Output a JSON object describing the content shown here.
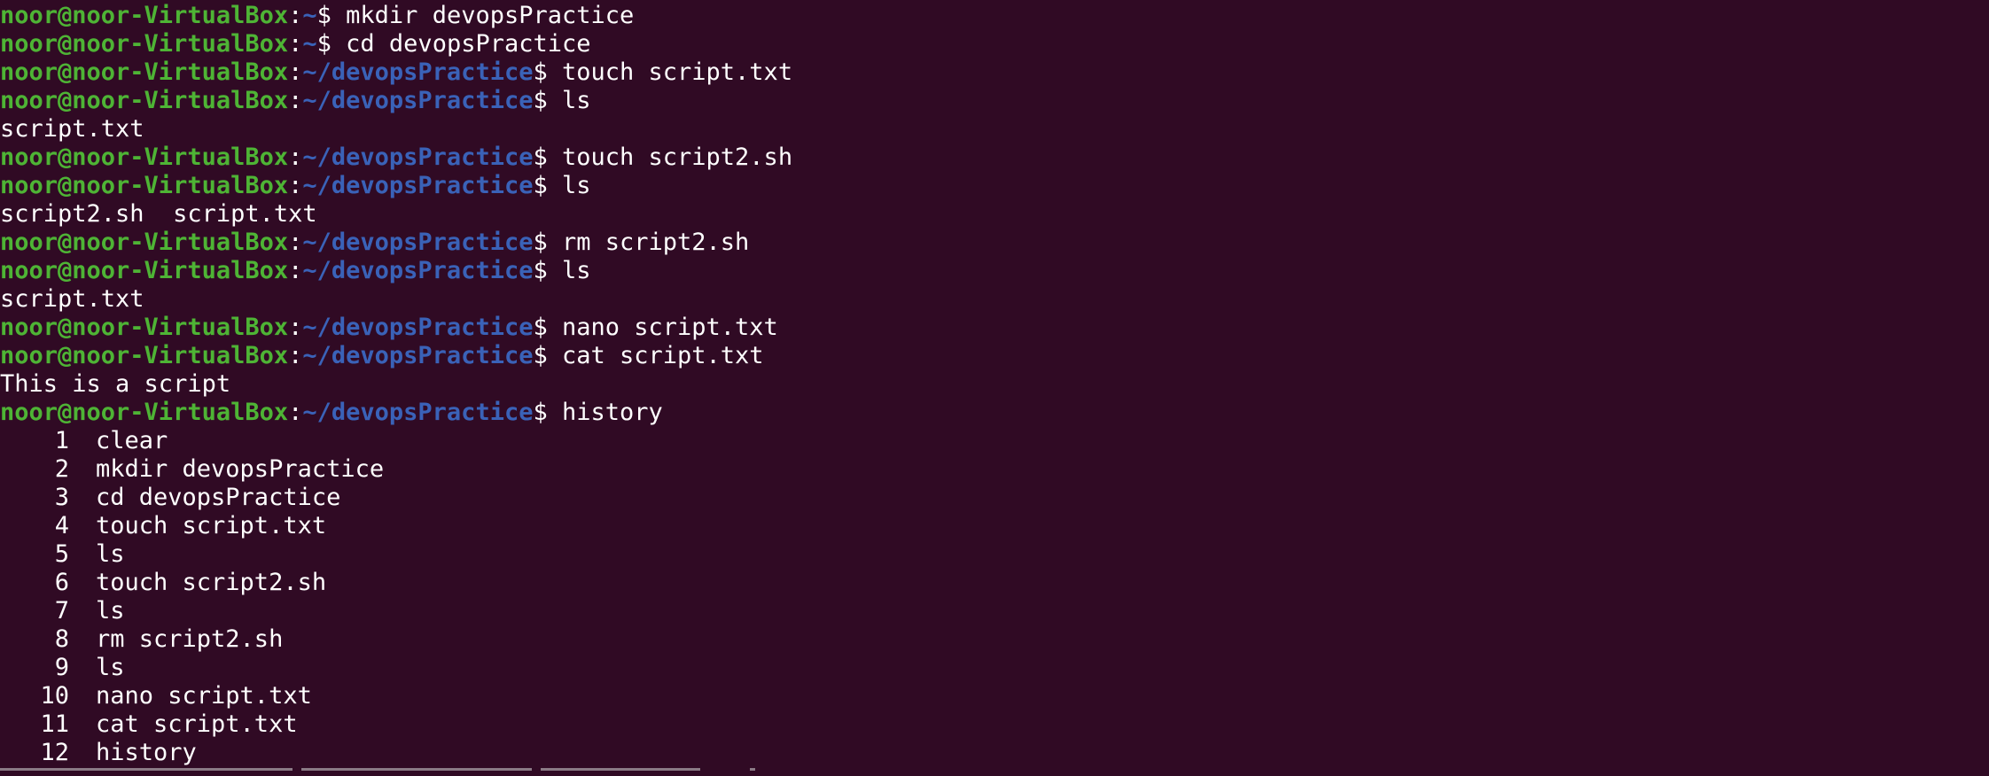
{
  "terminal": {
    "lines": [
      {
        "type": "prompt",
        "user": "noor@noor-VirtualBox",
        "sep": ":",
        "path": "~",
        "dollar": "$ ",
        "cmd": "mkdir devopsPractice"
      },
      {
        "type": "prompt",
        "user": "noor@noor-VirtualBox",
        "sep": ":",
        "path": "~",
        "dollar": "$ ",
        "cmd": "cd devopsPractice"
      },
      {
        "type": "prompt",
        "user": "noor@noor-VirtualBox",
        "sep": ":",
        "path": "~/devopsPractice",
        "dollar": "$ ",
        "cmd": "touch script.txt"
      },
      {
        "type": "prompt",
        "user": "noor@noor-VirtualBox",
        "sep": ":",
        "path": "~/devopsPractice",
        "dollar": "$ ",
        "cmd": "ls"
      },
      {
        "type": "output",
        "text": "script.txt"
      },
      {
        "type": "prompt",
        "user": "noor@noor-VirtualBox",
        "sep": ":",
        "path": "~/devopsPractice",
        "dollar": "$ ",
        "cmd": "touch script2.sh"
      },
      {
        "type": "prompt",
        "user": "noor@noor-VirtualBox",
        "sep": ":",
        "path": "~/devopsPractice",
        "dollar": "$ ",
        "cmd": "ls"
      },
      {
        "type": "output",
        "text": "script2.sh  script.txt"
      },
      {
        "type": "prompt",
        "user": "noor@noor-VirtualBox",
        "sep": ":",
        "path": "~/devopsPractice",
        "dollar": "$ ",
        "cmd": "rm script2.sh"
      },
      {
        "type": "prompt",
        "user": "noor@noor-VirtualBox",
        "sep": ":",
        "path": "~/devopsPractice",
        "dollar": "$ ",
        "cmd": "ls"
      },
      {
        "type": "output",
        "text": "script.txt"
      },
      {
        "type": "prompt",
        "user": "noor@noor-VirtualBox",
        "sep": ":",
        "path": "~/devopsPractice",
        "dollar": "$ ",
        "cmd": "nano script.txt"
      },
      {
        "type": "prompt",
        "user": "noor@noor-VirtualBox",
        "sep": ":",
        "path": "~/devopsPractice",
        "dollar": "$ ",
        "cmd": "cat script.txt"
      },
      {
        "type": "output",
        "text": "This is a script"
      },
      {
        "type": "prompt",
        "user": "noor@noor-VirtualBox",
        "sep": ":",
        "path": "~/devopsPractice",
        "dollar": "$ ",
        "cmd": "history"
      },
      {
        "type": "history",
        "num": "1",
        "cmd": "clear"
      },
      {
        "type": "history",
        "num": "2",
        "cmd": "mkdir devopsPractice"
      },
      {
        "type": "history",
        "num": "3",
        "cmd": "cd devopsPractice"
      },
      {
        "type": "history",
        "num": "4",
        "cmd": "touch script.txt"
      },
      {
        "type": "history",
        "num": "5",
        "cmd": "ls"
      },
      {
        "type": "history",
        "num": "6",
        "cmd": "touch script2.sh"
      },
      {
        "type": "history",
        "num": "7",
        "cmd": "ls"
      },
      {
        "type": "history",
        "num": "8",
        "cmd": "rm script2.sh"
      },
      {
        "type": "history",
        "num": "9",
        "cmd": "ls"
      },
      {
        "type": "history",
        "num": "10",
        "cmd": "nano script.txt"
      },
      {
        "type": "history",
        "num": "11",
        "cmd": "cat script.txt"
      },
      {
        "type": "history",
        "num": "12",
        "cmd": "history"
      }
    ]
  },
  "colors": {
    "background": "#300a24",
    "user_host": "#4eb435",
    "path": "#3a62b8",
    "text": "#ffffff"
  }
}
